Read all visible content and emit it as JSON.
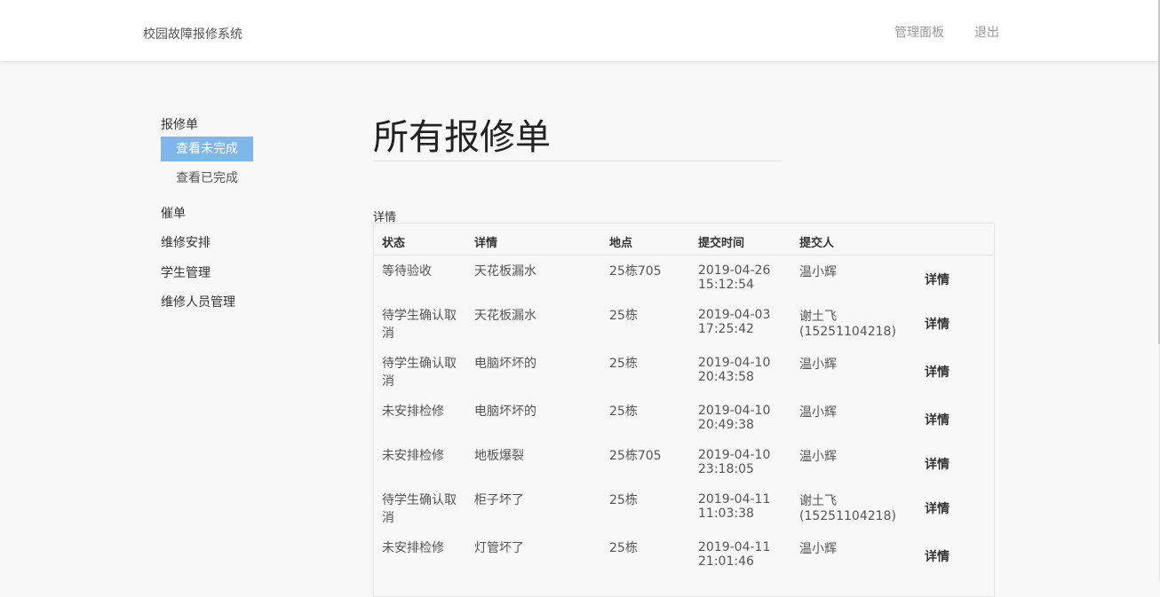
{
  "app": {
    "brand": "校园故障报修系统",
    "nav": {
      "dashboard": "管理面板",
      "logout": "退出"
    }
  },
  "sidebar": {
    "section_orders": "报修单",
    "sub_unfinished": "查看未完成",
    "sub_finished": "查看已完成",
    "item_urge": "催单",
    "item_schedule": "维修安排",
    "item_students": "学生管理",
    "item_staff": "维修人员管理"
  },
  "main": {
    "title": "所有报修单",
    "table_caption": "详情",
    "columns": [
      "状态",
      "详情",
      "地点",
      "提交时间",
      "提交人",
      ""
    ],
    "rows": [
      {
        "status": "等待验收",
        "detail": "天花板漏水",
        "location": "25栋705",
        "date": "2019-04-26",
        "time": "15:12:54",
        "person": "温小辉",
        "person_phone": "",
        "action": "详情"
      },
      {
        "status": "待学生确认取消",
        "detail": "天花板漏水",
        "location": "25栋",
        "date": "2019-04-03",
        "time": "17:25:42",
        "person": "谢土飞",
        "person_phone": "(15251104218)",
        "action": "详情"
      },
      {
        "status": "待学生确认取消",
        "detail": "电脑坏坏的",
        "location": "25栋",
        "date": "2019-04-10",
        "time": "20:43:58",
        "person": "温小辉",
        "person_phone": "",
        "action": "详情"
      },
      {
        "status": "未安排检修",
        "detail": "电脑坏坏的",
        "location": "25栋",
        "date": "2019-04-10",
        "time": "20:49:38",
        "person": "温小辉",
        "person_phone": "",
        "action": "详情"
      },
      {
        "status": "未安排检修",
        "detail": "地板爆裂",
        "location": "25栋705",
        "date": "2019-04-10",
        "time": "23:18:05",
        "person": "温小辉",
        "person_phone": "",
        "action": "详情"
      },
      {
        "status": "待学生确认取消",
        "detail": "柜子坏了",
        "location": "25栋",
        "date": "2019-04-11",
        "time": "11:03:38",
        "person": "谢土飞",
        "person_phone": "(15251104218)",
        "action": "详情"
      },
      {
        "status": "未安排检修",
        "detail": "灯管坏了",
        "location": "25栋",
        "date": "2019-04-11",
        "time": "21:01:46",
        "person": "温小辉",
        "person_phone": "",
        "action": "详情"
      }
    ]
  },
  "colors": {
    "active_bg": "#7fb7ea",
    "page_bg": "#f8f8f8",
    "topbar_bg": "#ffffff"
  }
}
